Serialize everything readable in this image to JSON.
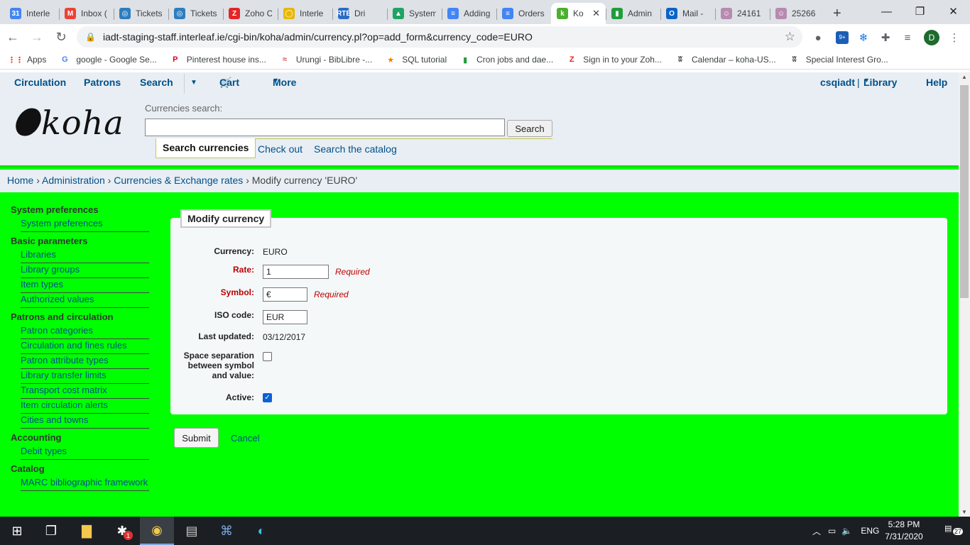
{
  "browser": {
    "tabs": [
      {
        "label": "Interle",
        "icon_text": "31",
        "color": "#4285f4"
      },
      {
        "label": "Inbox (",
        "icon_text": "M",
        "color": "#ea4335"
      },
      {
        "label": "Tickets",
        "icon_text": "◎",
        "color": "#2e7dbe"
      },
      {
        "label": "Tickets",
        "icon_text": "◎",
        "color": "#2e7dbe"
      },
      {
        "label": "Zoho C",
        "icon_text": "Z",
        "color": "#e42527"
      },
      {
        "label": "Interle",
        "icon_text": "◯",
        "color": "#e8b800"
      },
      {
        "label": "Dri",
        "icon_text": "RTÉ",
        "color": "#2b6cc4"
      },
      {
        "label": "System",
        "icon_text": "▲",
        "color": "#1fa463"
      },
      {
        "label": "Adding",
        "icon_text": "≡",
        "color": "#4285f4"
      },
      {
        "label": "Orders",
        "icon_text": "≡",
        "color": "#4285f4"
      },
      {
        "label": "Ko",
        "icon_text": "k",
        "color": "#4caf2f"
      },
      {
        "label": "Admin",
        "icon_text": "▮",
        "color": "#1e9e3a"
      },
      {
        "label": "Mail -",
        "icon_text": "O",
        "color": "#0a64c8"
      },
      {
        "label": "24161",
        "icon_text": "☺",
        "color": "#b88ab0"
      },
      {
        "label": "25266",
        "icon_text": "☺",
        "color": "#b88ab0"
      }
    ],
    "active_tab_index": 10,
    "url": "iadt-staging-staff.interleaf.ie/cgi-bin/koha/admin/currency.pl?op=add_form&currency_code=EURO",
    "profile_initial": "D",
    "ext_badge": "9+",
    "bookmarks": [
      {
        "label": "Apps",
        "icon_text": "⋮⋮",
        "color": "#e53935"
      },
      {
        "label": "google - Google Se...",
        "icon_text": "G",
        "color": "#4285f4"
      },
      {
        "label": "Pinterest house ins...",
        "icon_text": "P",
        "color": "#e60023"
      },
      {
        "label": "Urungi - BibLibre -...",
        "icon_text": "≈",
        "color": "#d44"
      },
      {
        "label": "SQL tutorial",
        "icon_text": "★",
        "color": "#f57c00"
      },
      {
        "label": "Cron jobs and dae...",
        "icon_text": "▮",
        "color": "#1e9e3a"
      },
      {
        "label": "Sign in to your Zoh...",
        "icon_text": "Z",
        "color": "#e42527"
      },
      {
        "label": "Calendar – koha-US...",
        "icon_text": "ʬ",
        "color": "#333"
      },
      {
        "label": "Special Interest Gro...",
        "icon_text": "ʬ",
        "color": "#333"
      }
    ]
  },
  "koha": {
    "nav": {
      "circulation": "Circulation",
      "patrons": "Patrons",
      "search": "Search",
      "cart": "Cart",
      "more": "More",
      "user": "csqiadt",
      "separator": "|",
      "library": "Library",
      "help": "Help"
    },
    "logo_text": "koha",
    "search": {
      "label": "Currencies search:",
      "button": "Search",
      "tabs": [
        "Search currencies",
        "Check out",
        "Search the catalog"
      ]
    },
    "breadcrumb": {
      "home": "Home",
      "admin": "Administration",
      "currencies": "Currencies & Exchange rates",
      "current": "Modify currency 'EURO'",
      "sep": "›"
    },
    "sidebar": [
      {
        "heading": "System preferences",
        "items": [
          "System preferences"
        ]
      },
      {
        "heading": "Basic parameters",
        "items": [
          "Libraries",
          "Library groups",
          "Item types",
          "Authorized values"
        ]
      },
      {
        "heading": "Patrons and circulation",
        "items": [
          "Patron categories",
          "Circulation and fines rules",
          "Patron attribute types",
          "Library transfer limits",
          "Transport cost matrix",
          "Item circulation alerts",
          "Cities and towns"
        ]
      },
      {
        "heading": "Accounting",
        "items": [
          "Debit types"
        ]
      },
      {
        "heading": "Catalog",
        "items": [
          "MARC bibliographic framework"
        ]
      }
    ],
    "form": {
      "legend": "Modify currency",
      "currency_label": "Currency:",
      "currency_value": "EURO",
      "rate_label": "Rate:",
      "rate_value": "1",
      "symbol_label": "Symbol:",
      "symbol_value": "€",
      "required_text": "Required",
      "iso_label": "ISO code:",
      "iso_value": "EUR",
      "updated_label": "Last updated:",
      "updated_value": "03/12/2017",
      "space_label": "Space separation between symbol and value:",
      "space_checked": false,
      "active_label": "Active:",
      "active_checked": true,
      "submit": "Submit",
      "cancel": "Cancel"
    }
  },
  "taskbar": {
    "language": "ENG",
    "time": "5:28 PM",
    "date": "7/31/2020",
    "notifications": "27",
    "slack_badge": "1"
  }
}
